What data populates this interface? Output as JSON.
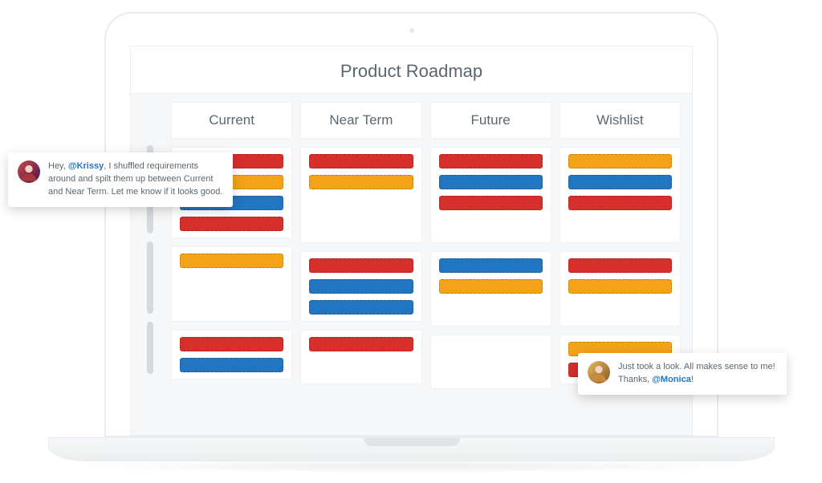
{
  "title": "Product Roadmap",
  "columns": [
    "Current",
    "Near Term",
    "Future",
    "Wishlist"
  ],
  "colors": {
    "red": "#d62f2c",
    "orange": "#f3a21a",
    "blue": "#2175c1"
  },
  "rows": [
    {
      "cells": [
        [
          "red",
          "orange",
          "blue",
          "red"
        ],
        [
          "red",
          "orange"
        ],
        [
          "red",
          "blue",
          "red"
        ],
        [
          "orange",
          "blue",
          "red"
        ]
      ]
    },
    {
      "cells": [
        [
          "orange"
        ],
        [
          "red",
          "blue",
          "blue"
        ],
        [
          "blue",
          "orange"
        ],
        [
          "red",
          "orange"
        ]
      ]
    },
    {
      "cells": [
        [
          "red",
          "blue"
        ],
        [
          "red"
        ],
        [],
        [
          "orange",
          "red"
        ]
      ]
    }
  ],
  "comments": [
    {
      "pre": "Hey, ",
      "mention": "@Krissy",
      "post": ", I shuffled requirements around and spilt them up between Current and Near Term. Let me know if it looks good."
    },
    {
      "pre": "Just took a look. All makes sense to me! Thanks, ",
      "mention": "@Monica",
      "post": "!"
    }
  ]
}
